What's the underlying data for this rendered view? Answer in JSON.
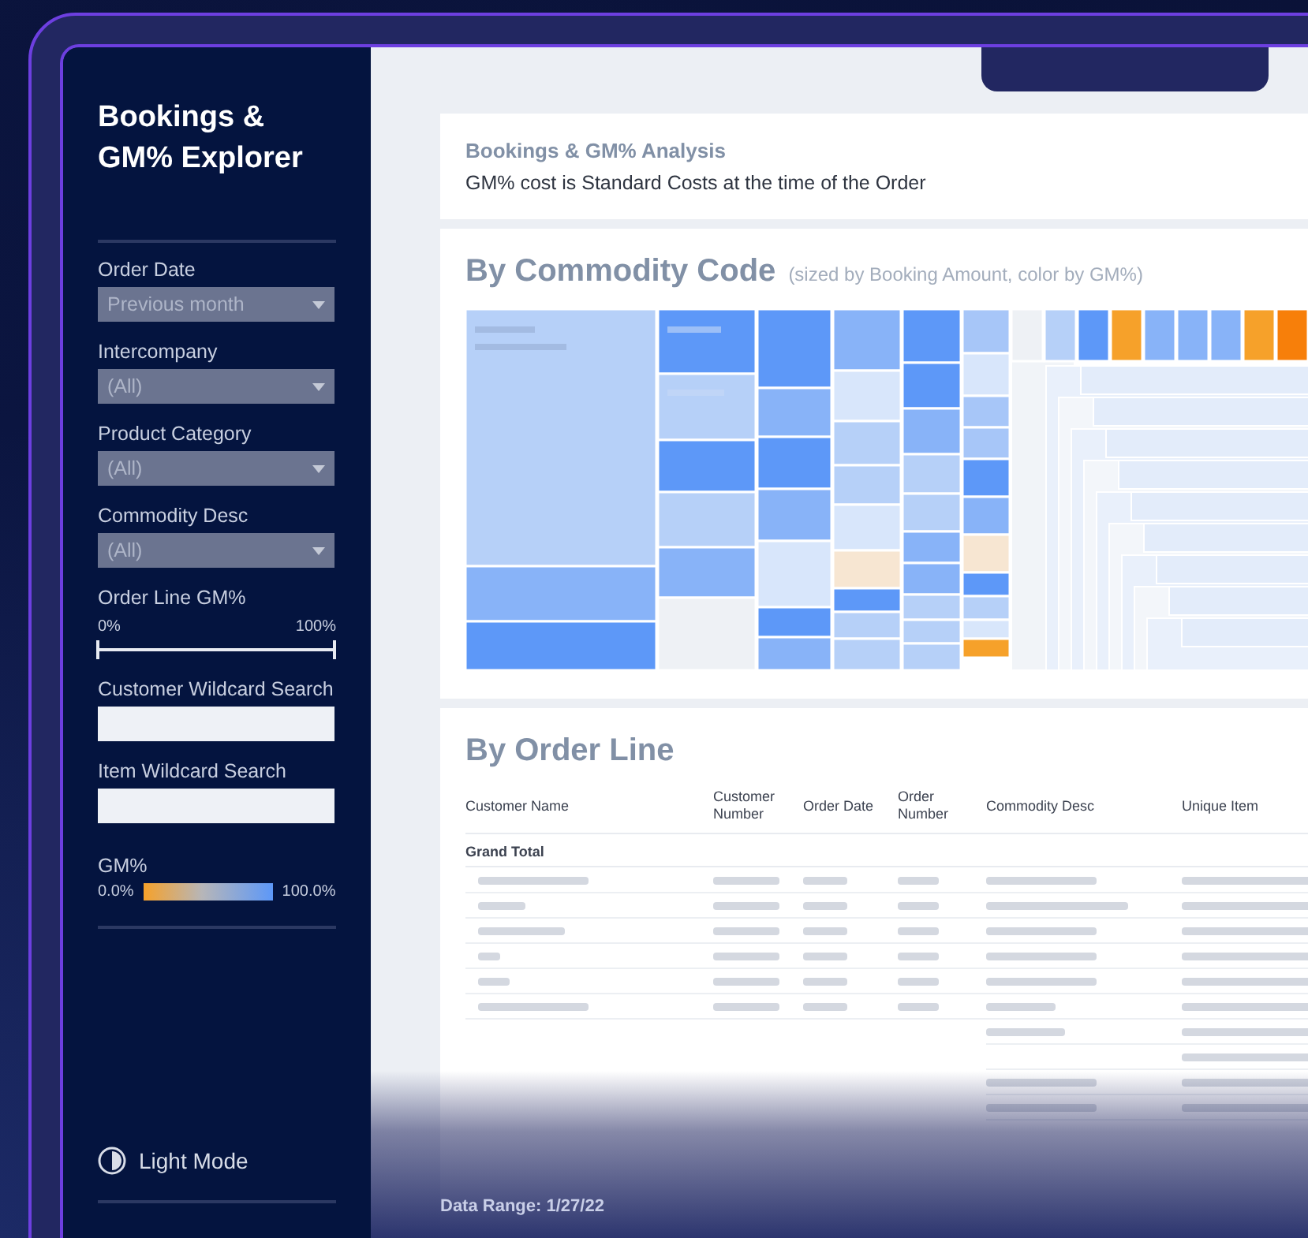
{
  "sidebar": {
    "title": "Bookings & GM% Explorer",
    "filters": [
      {
        "kind": "dropdown",
        "label": "Order Date",
        "value": "Previous month"
      },
      {
        "kind": "dropdown",
        "label": "Intercompany",
        "value": "(All)"
      },
      {
        "kind": "dropdown",
        "label": "Product Category",
        "value": "(All)"
      },
      {
        "kind": "dropdown",
        "label": "Commodity Desc",
        "value": "(All)"
      },
      {
        "kind": "range",
        "label": "Order Line GM%",
        "min_label": "0%",
        "max_label": "100%",
        "handles": [
          {
            "level": 0
          },
          {
            "level": 1
          }
        ]
      },
      {
        "kind": "search",
        "label": "Customer Wildcard Search"
      },
      {
        "kind": "search",
        "label": "Item Wildcard Search"
      },
      {
        "kind": "legend",
        "label": "GM%",
        "min_label": "0.0%",
        "max_label": "100.0%"
      }
    ],
    "mode_toggle": {
      "label": "Light Mode"
    }
  },
  "header": {
    "title": "Bookings & GM% Analysis",
    "subtitle": "GM% cost is Standard Costs at the time of the Order"
  },
  "treemap": {
    "title": "By Commodity Code",
    "subtitle": "(sized by Booking Amount, color by GM%)"
  },
  "table": {
    "title": "By Order Line",
    "columns": [
      "Customer Name",
      "Customer Number",
      "Order Date",
      "Order Number",
      "Commodity Desc",
      "Unique Item"
    ],
    "grand_total": "Grand Total"
  },
  "footer": {
    "data_range": "Data Range: 1/27/22"
  }
}
